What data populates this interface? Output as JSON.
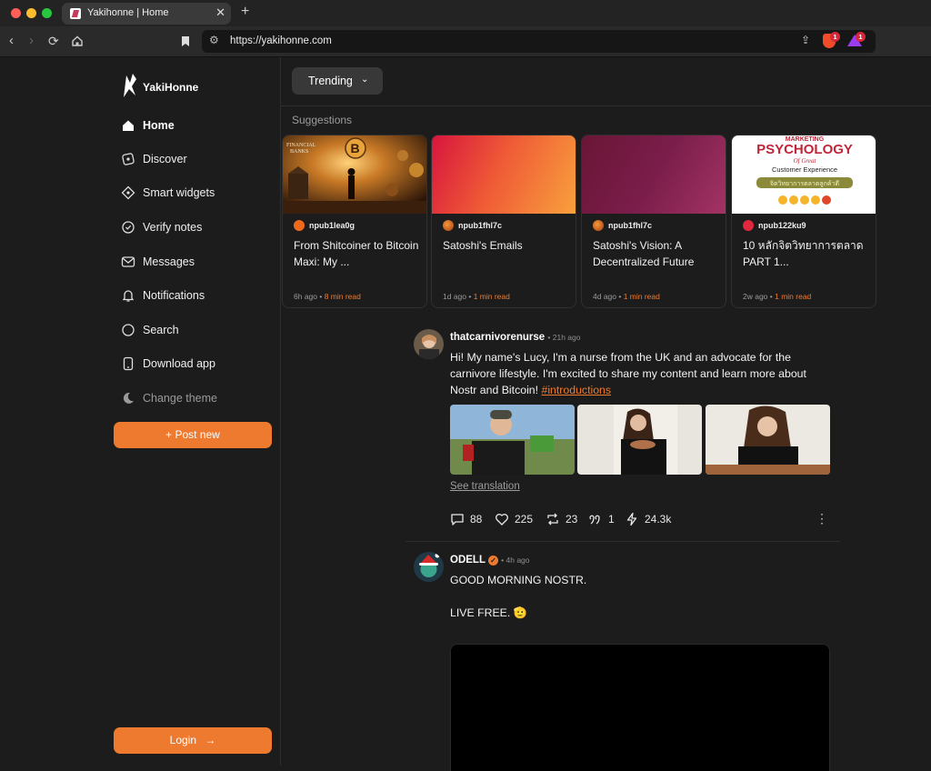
{
  "browser": {
    "tab_title": "Yakihonne | Home",
    "url": "https://yakihonne.com",
    "shield_badge": "1",
    "rewards_badge": "1"
  },
  "sidebar": {
    "brand": "YakiHonne",
    "items": [
      {
        "label": "Home",
        "icon": "home-icon"
      },
      {
        "label": "Discover",
        "icon": "discover-icon"
      },
      {
        "label": "Smart widgets",
        "icon": "smart-widgets-icon"
      },
      {
        "label": "Verify notes",
        "icon": "verify-notes-icon"
      },
      {
        "label": "Messages",
        "icon": "messages-icon"
      },
      {
        "label": "Notifications",
        "icon": "bell-icon"
      },
      {
        "label": "Search",
        "icon": "search-icon"
      },
      {
        "label": "Download app",
        "icon": "phone-icon"
      },
      {
        "label": "Change theme",
        "icon": "moon-icon"
      }
    ],
    "post_new": "+ Post new",
    "login": "Login"
  },
  "feed": {
    "filter_label": "Trending",
    "suggestions_title": "Suggestions",
    "cards": [
      {
        "author": "npub1lea0g",
        "title": "From Shitcoiner to Bitcoin Maxi: My ...",
        "time": "6h ago",
        "read": "8 min read"
      },
      {
        "author": "npub1fhl7c",
        "title": "Satoshi's Emails",
        "time": "1d ago",
        "read": "1 min read"
      },
      {
        "author": "npub1fhl7c",
        "title": "Satoshi's Vision: A Decentralized Future",
        "time": "4d ago",
        "read": "1 min read"
      },
      {
        "author": "npub122ku9",
        "title": "10 หลักจิตวิทยาการตลาด PART 1...",
        "time": "2w ago",
        "read": "1 min read",
        "image_text": {
          "top": "MARKETING",
          "main": "PSYCHOLOGY",
          "of": "Of Great",
          "sub": "Customer Experience",
          "banner": "จิตวิทยาการตลาดลูกค้าดี"
        }
      }
    ],
    "posts": [
      {
        "author": "thatcarnivorenurse",
        "time": "21h ago",
        "text": "Hi! My name's Lucy, I'm a nurse from the UK and an advocate for the carnivore lifestyle. I'm excited to share my content and learn more about Nostr and Bitcoin! ",
        "hashtag": "#introductions",
        "see_translation": "See translation",
        "comments": "88",
        "likes": "225",
        "reposts": "23",
        "quotes": "1",
        "zaps": "24.3k"
      },
      {
        "author": "ODELL",
        "time": "4h ago",
        "line1": "GOOD MORNING NOSTR.",
        "line2": "LIVE FREE. 🫡"
      }
    ]
  },
  "colors": {
    "accent": "#ee7a30",
    "background": "#1c1c1c"
  }
}
